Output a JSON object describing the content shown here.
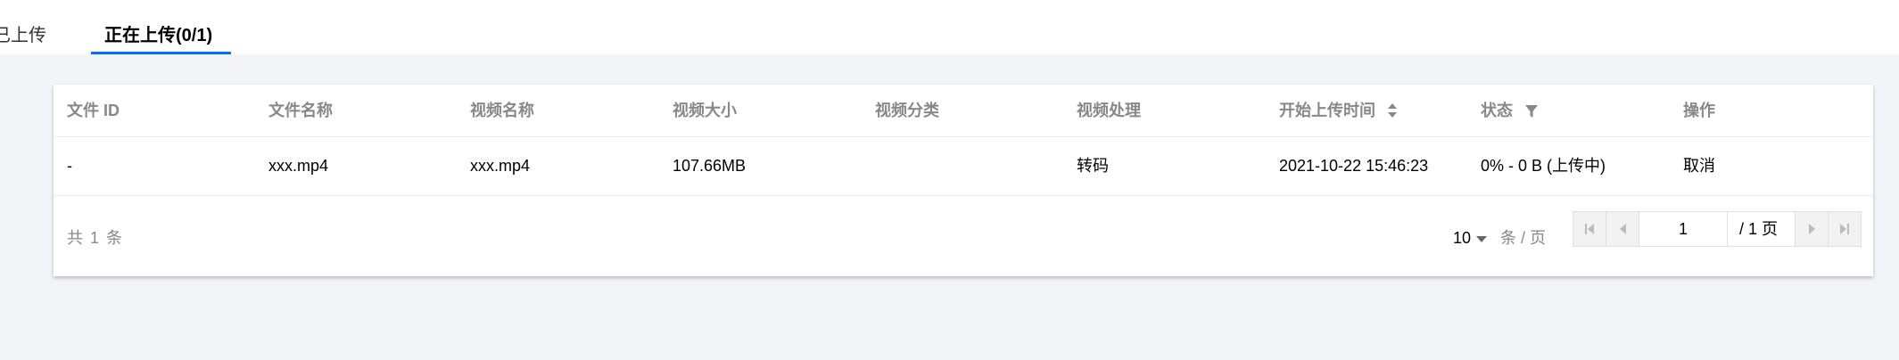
{
  "tabs": {
    "uploaded": "已上传",
    "uploading": "正在上传(0/1)"
  },
  "table": {
    "columns": [
      "文件 ID",
      "文件名称",
      "视频名称",
      "视频大小",
      "视频分类",
      "视频处理",
      "开始上传时间",
      "状态",
      "操作"
    ],
    "rows": [
      {
        "file_id": "-",
        "file_name": "xxx.mp4",
        "video_name": "xxx.mp4",
        "video_size": "107.66MB",
        "video_category": "",
        "video_processing": "转码",
        "start_time": "2021-10-22 15:46:23",
        "status": "0% - 0 B (上传中)",
        "action": "取消"
      }
    ]
  },
  "pagination": {
    "total_prefix": "共",
    "total_count": "1",
    "total_suffix": "条",
    "page_size": "10",
    "page_size_unit": "条 / 页",
    "current_page": "1",
    "total_pages_label": "/ 1 页"
  },
  "icons": {
    "sort": "sort-icon",
    "filter": "filter-icon",
    "dropdown": "chevron-down-icon",
    "first": "first-page-icon",
    "prev": "prev-page-icon",
    "next": "next-page-icon",
    "last": "last-page-icon"
  },
  "colors": {
    "accent": "#006eff",
    "page_bg": "#f3f4f7",
    "muted_text": "#888888"
  }
}
